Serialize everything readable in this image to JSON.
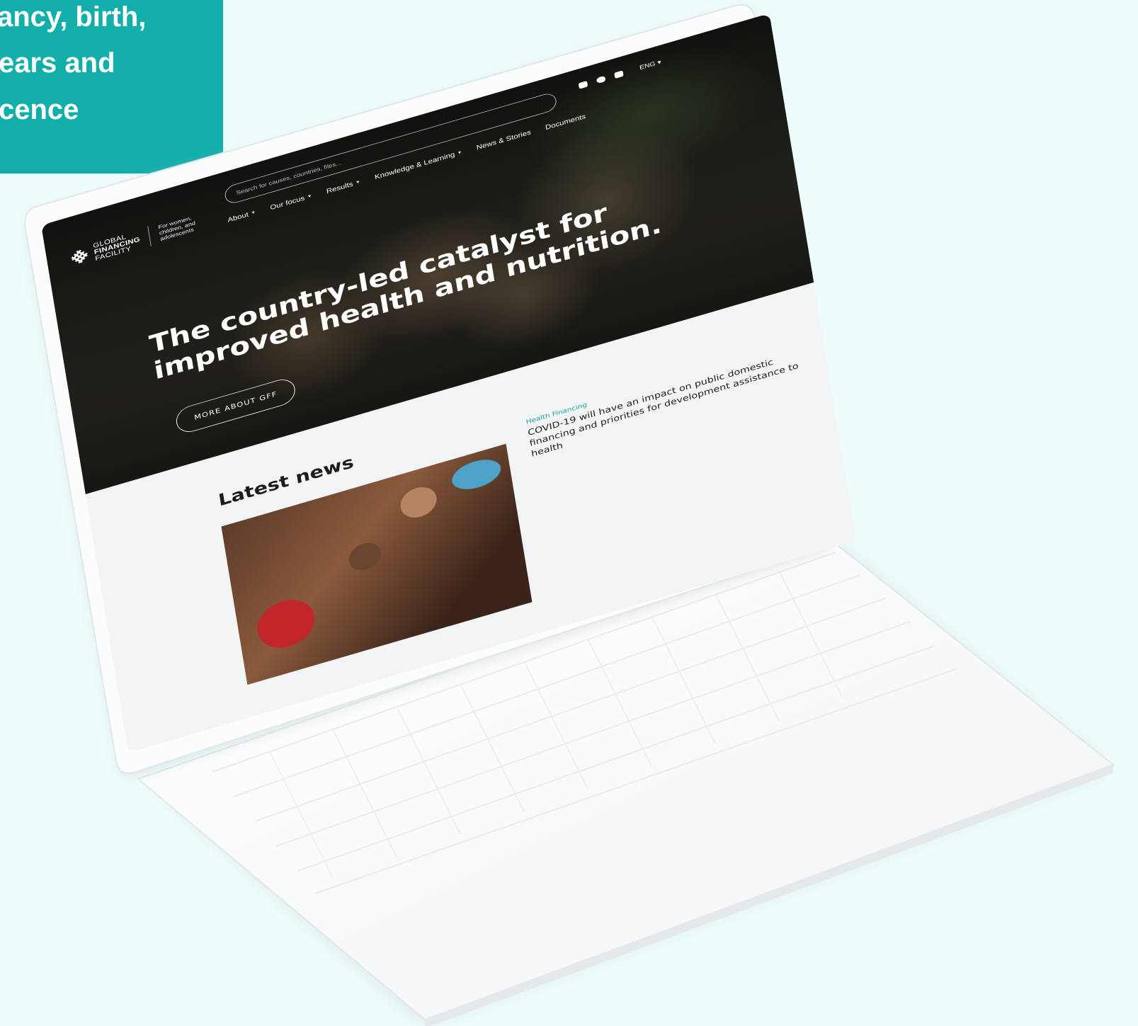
{
  "banner": {
    "line1": "ancy, birth,",
    "line2": "ears and",
    "line3": "cence"
  },
  "site": {
    "logo": {
      "line1": "GLOBAL",
      "line2": "FINANCING",
      "line3": "FACILITY",
      "tagline1": "For women,",
      "tagline2": "children, and",
      "tagline3": "adolescents"
    },
    "search": {
      "placeholder": "Search for causes, countries, files..."
    },
    "social_icons": [
      "youtube-icon",
      "twitter-icon",
      "flickr-icon"
    ],
    "language": "ENG ▾",
    "nav": [
      {
        "label": "About",
        "has_caret": true
      },
      {
        "label": "Our focus",
        "has_caret": true
      },
      {
        "label": "Results",
        "has_caret": true
      },
      {
        "label": "Knowledge & Learning",
        "has_caret": true
      },
      {
        "label": "News & Stories",
        "has_caret": false
      },
      {
        "label": "Documents",
        "has_caret": false
      }
    ],
    "headline": "The country-led catalyst for improved health and nutrition.",
    "cta": "MORE ABOUT GFF",
    "news": {
      "section_title": "Latest news",
      "item": {
        "category": "Health Financing",
        "headline": "COVID-19 will have an impact on public domestic financing and priorities for development assistance to health"
      }
    }
  },
  "colors": {
    "background": "#eefcfb",
    "banner": "#12aeaa",
    "accent": "#19a3a0"
  }
}
